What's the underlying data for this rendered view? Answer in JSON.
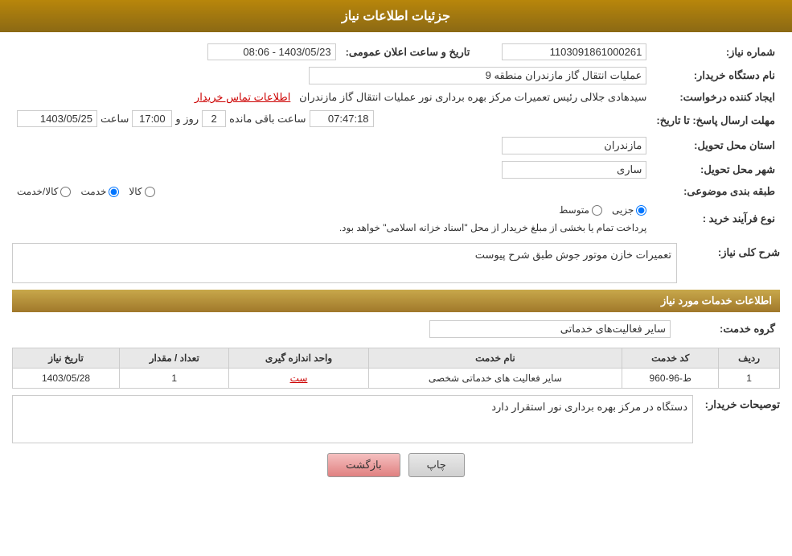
{
  "header": {
    "title": "جزئیات اطلاعات نیاز"
  },
  "fields": {
    "need_number_label": "شماره نیاز:",
    "need_number_value": "1103091861000261",
    "date_label": "تاریخ و ساعت اعلان عمومی:",
    "date_value": "1403/05/23 - 08:06",
    "buyer_org_label": "نام دستگاه خریدار:",
    "buyer_org_value": "عملیات انتقال گاز مازندران منطقه 9",
    "creator_label": "ایجاد کننده درخواست:",
    "creator_value": "سیدهادی جلالی رئیس تعمیرات مرکز بهره برداری نور عملیات انتقال گاز مازندران",
    "contact_link": "اطلاعات تماس خریدار",
    "response_deadline_label": "مهلت ارسال پاسخ: تا تاریخ:",
    "response_date_value": "1403/05/25",
    "response_time_label": "ساعت",
    "response_time_value": "17:00",
    "response_days_label": "روز و",
    "response_days_value": "2",
    "response_remaining_label": "ساعت باقی مانده",
    "response_remaining_value": "07:47:18",
    "province_label": "استان محل تحویل:",
    "province_value": "مازندران",
    "city_label": "شهر محل تحویل:",
    "city_value": "ساری",
    "category_label": "طبقه بندی موضوعی:",
    "category_options": [
      "کالا",
      "خدمت",
      "کالا/خدمت"
    ],
    "category_selected": "خدمت",
    "purchase_type_label": "نوع فرآیند خرید :",
    "purchase_options": [
      "جزیی",
      "متوسط"
    ],
    "purchase_note": "پرداخت تمام یا بخشی از مبلغ خریدار از محل \"اسناد خزانه اسلامی\" خواهد بود."
  },
  "need_description": {
    "section_title": "شرح کلی نیاز:",
    "description": "تعمیرات خازن موتور جوش طبق شرح پیوست"
  },
  "services_section": {
    "title": "اطلاعات خدمات مورد نیاز",
    "service_group_label": "گروه خدمت:",
    "service_group_value": "سایر فعالیت‌های خدماتی"
  },
  "table": {
    "headers": [
      "ردیف",
      "کد خدمت",
      "نام خدمت",
      "واحد اندازه گیری",
      "تعداد / مقدار",
      "تاریخ نیاز"
    ],
    "rows": [
      {
        "row": "1",
        "code": "ط-96-960",
        "name": "سایر فعالیت های خدماتی شخصی",
        "unit": "ست",
        "quantity": "1",
        "date": "1403/05/28"
      }
    ]
  },
  "buyer_description": {
    "label": "توصیحات خریدار:",
    "text": "دستگاه در مرکز بهره برداری نور استقرار دارد"
  },
  "buttons": {
    "print": "چاپ",
    "back": "بازگشت"
  }
}
